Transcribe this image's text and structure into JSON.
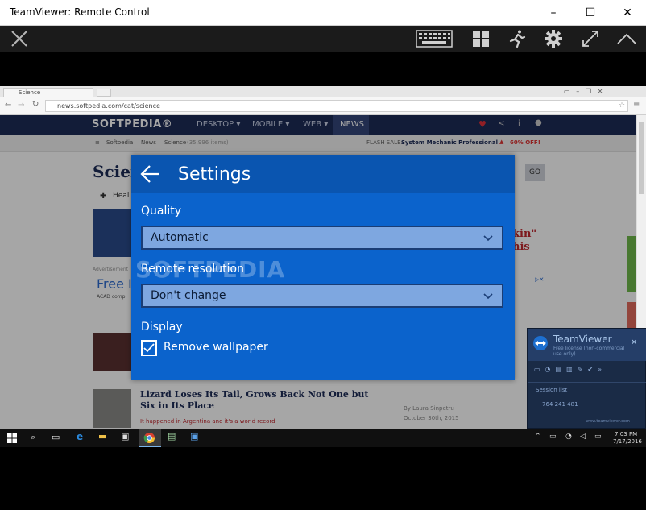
{
  "window": {
    "title": "TeamViewer: Remote Control",
    "minimize": "–",
    "maximize": "☐",
    "close": "✕"
  },
  "toolbar": {
    "icons": [
      "close-session-icon",
      "keyboard-icon",
      "windows-icon",
      "actions-icon",
      "gear-icon",
      "fullscreen-icon",
      "collapse-icon"
    ]
  },
  "remote_browser": {
    "tab_title": "Science",
    "url": "news.softpedia.com/cat/science"
  },
  "softpedia": {
    "logo": "SOFTPEDIA®",
    "nav": [
      "DESKTOP ▾",
      "MOBILE ▾",
      "WEB ▾",
      "NEWS"
    ],
    "crumb": [
      "Softpedia",
      "News",
      "Science",
      "(35,996 items)"
    ],
    "flash_label": "FLASH SALE:",
    "flash_product": "System Mechanic Professional",
    "flash_discount": "60% OFF!",
    "page_heading": "Scien",
    "go_button": "GO",
    "filter_label": "Heal",
    "article_right_1": "kin\"",
    "article_right_2": "his",
    "ad_text": "Free I",
    "ad_sub": "ACAD comp",
    "advertisement": "Advertisement",
    "article_title": "Lizard Loses Its Tail, Grows Back Not One but Six in Its Place",
    "article_excerpt": "It happened in Argentina and it's a world record",
    "article_author": "By Laura Sinpetru",
    "article_date": "October 30th, 2015"
  },
  "settings": {
    "title": "Settings",
    "quality_label": "Quality",
    "quality_value": "Automatic",
    "resolution_label": "Remote resolution",
    "resolution_value": "Don't change",
    "display_label": "Display",
    "remove_wallpaper_label": "Remove wallpaper",
    "remove_wallpaper_checked": true
  },
  "watermark": "SOFTPEDIA",
  "teamviewer_panel": {
    "title": "TeamViewer",
    "subtitle": "Free license (non-commercial use only)",
    "session_label": "Session list",
    "session_id": "764 241 481",
    "footer": "www.teamviewer.com"
  },
  "taskbar": {
    "time": "7:03 PM",
    "date": "7/17/2016"
  },
  "colors": {
    "settings_bg": "#0b63cc",
    "settings_header": "#0a55b0",
    "nav_bg": "#1d2b57"
  }
}
